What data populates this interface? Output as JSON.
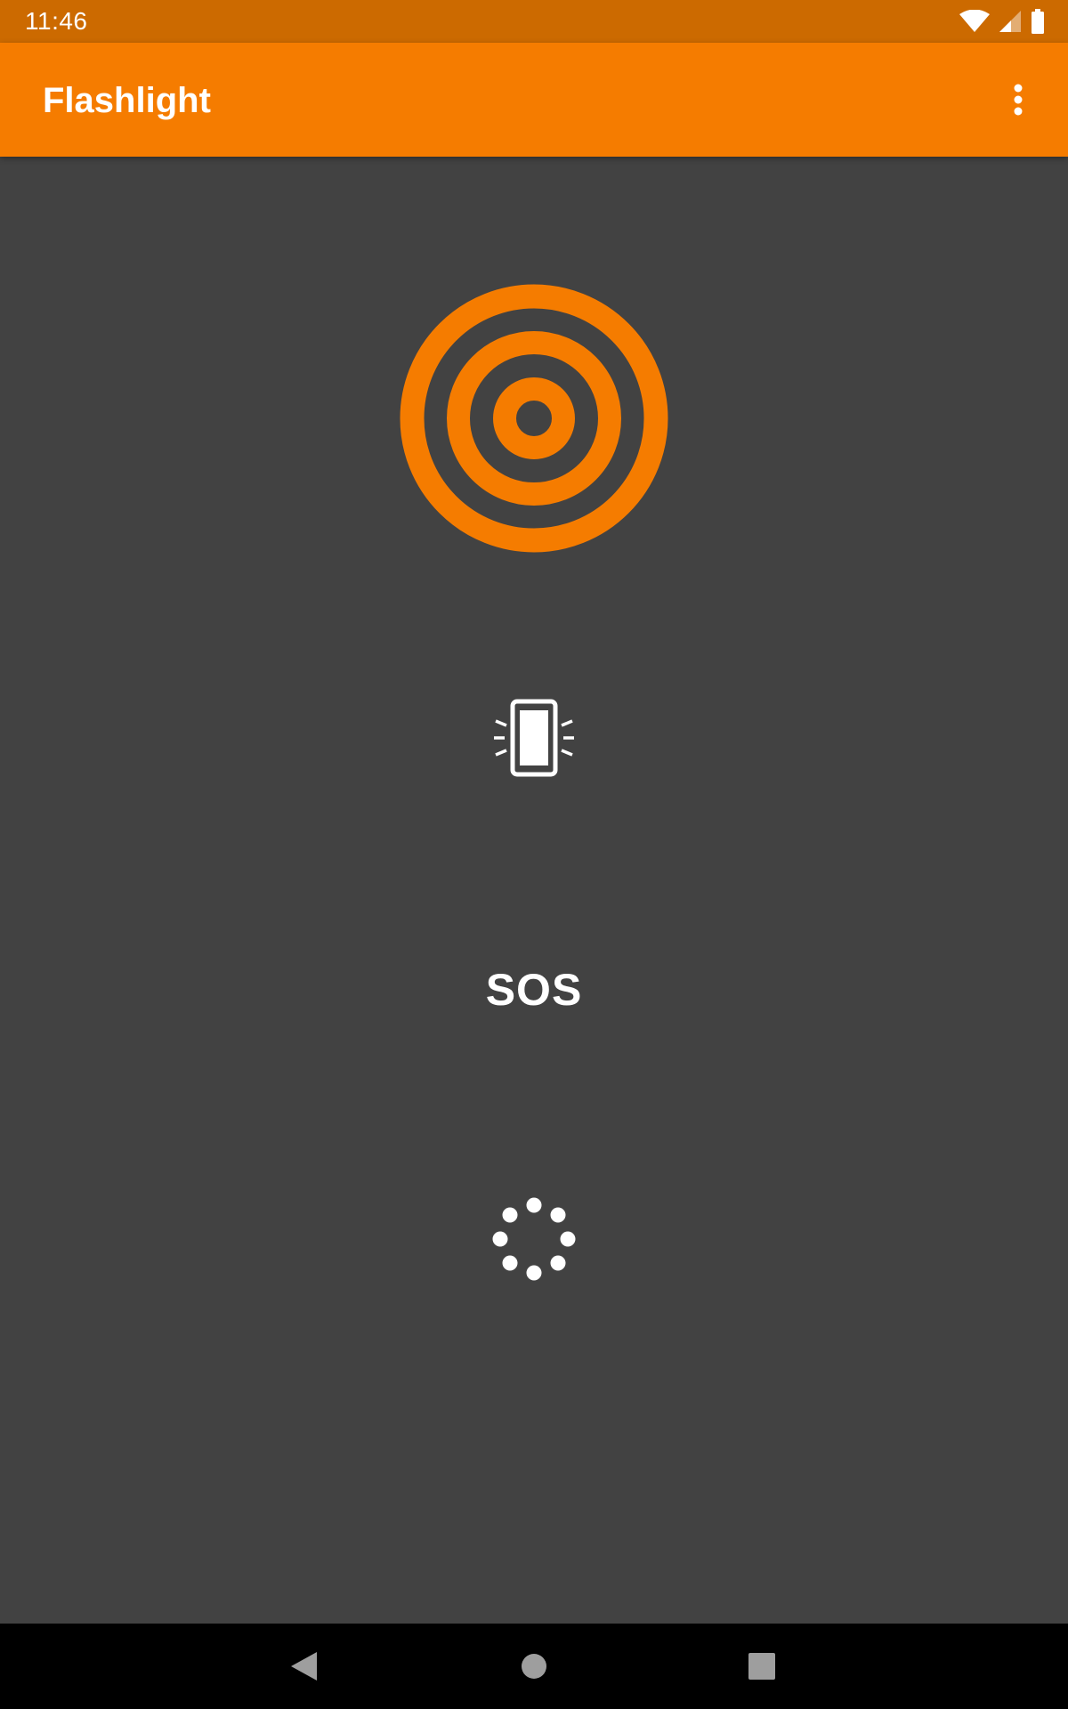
{
  "status_bar": {
    "time": "11:46",
    "icons": [
      "wifi-icon",
      "cell-signal-icon",
      "battery-icon"
    ]
  },
  "app_bar": {
    "title": "Flashlight",
    "overflow_icon": "more-vert-icon"
  },
  "main": {
    "flash_icon": "concentric-rings-icon",
    "stroboscope_icon": "vibrating-phone-icon",
    "sos_label": "SOS",
    "bright_display_icon": "dotted-circle-icon"
  },
  "nav_bar": {
    "icons": [
      "back-icon",
      "home-icon",
      "recents-icon"
    ]
  },
  "colors": {
    "accent": "#F57C00",
    "status_bar": "#CC6A00",
    "background": "#424242",
    "icon": "#FFFFFF",
    "nav_bar": "#000000",
    "nav_icon": "#9E9E9E"
  }
}
